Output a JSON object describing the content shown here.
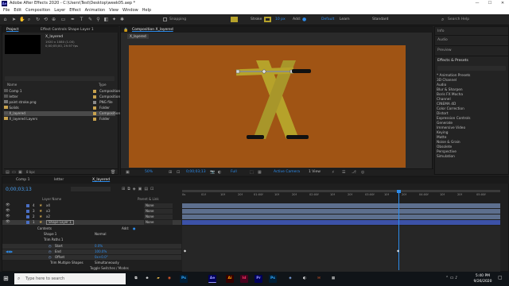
{
  "window": {
    "title": "Adobe After Effects 2020 - C:\\Users\\Test\\Desktop\\week05.aep *",
    "app_icon": "Ae"
  },
  "menu": [
    "File",
    "Edit",
    "Composition",
    "Layer",
    "Effect",
    "Animation",
    "View",
    "Window",
    "Help"
  ],
  "toolbar": {
    "snapping": "Snapping",
    "stroke": "Stroke",
    "stroke_width": "10 px",
    "add": "Add:",
    "default": "Default",
    "learn": "Learn",
    "standard": "Standard",
    "search": "Search Help"
  },
  "project": {
    "tab": "Project",
    "effect_tab": "Effect Controls Shape Layer 1",
    "preview_name": "X_layered",
    "preview_info": [
      "1920 x 1080 (1.00)",
      "0;00;05;00, 29.97 fps"
    ],
    "col_name": "Name",
    "col_type": "Type",
    "items": [
      {
        "name": "Comp 1",
        "type": "Composition",
        "color": "#c8a24e"
      },
      {
        "name": "letter",
        "type": "Composition",
        "color": "#c8a24e"
      },
      {
        "name": "paint stroke.png",
        "type": "PNG file",
        "color": "#8a8a8a"
      },
      {
        "name": "Solids",
        "type": "Folder",
        "color": "#c8a24e"
      },
      {
        "name": "X_layered",
        "type": "Composition",
        "color": "#c8a24e"
      },
      {
        "name": "X_layered Layers",
        "type": "Folder",
        "color": "#c8a24e"
      }
    ],
    "bpc": "8 bpc"
  },
  "comp": {
    "tab": "Composition X_layered",
    "crumb": "X_layered",
    "zoom": "50%",
    "time": "0;00;03;13",
    "res": "Full",
    "camera": "Active Camera",
    "view": "1 View",
    "colors": {
      "bg": "#a05414",
      "x": "#b6a22a",
      "x_dark": "#9c8a22",
      "canvas": "#2a2a2a"
    }
  },
  "right_panel": {
    "sections": [
      "Info",
      "Audio",
      "Preview"
    ],
    "effects_title": "Effects & Presets",
    "effects": [
      "* Animation Presets",
      "3D Channel",
      "Audio",
      "Blur & Sharpen",
      "Boris FX Mocha",
      "Channel",
      "CINEMA 4D",
      "Color Correction",
      "Distort",
      "Expression Controls",
      "Generate",
      "Immersive Video",
      "Keying",
      "Matte",
      "Noise & Grain",
      "Obsolete",
      "Perspective",
      "Simulation"
    ]
  },
  "timeline": {
    "tabs": [
      "Comp 1",
      "letter",
      "X_layered"
    ],
    "timecode": "0;00;03;13",
    "col_layer": "Layer Name",
    "col_parent": "Parent & Link",
    "ruler": [
      "0s",
      "01f",
      "10f",
      "20f",
      "01:00f",
      "10f",
      "20f",
      "02:00f",
      "10f",
      "20f",
      "03:00f",
      "10f",
      "20f",
      "04:00f",
      "10f",
      "20f",
      "05:00f"
    ],
    "layers": [
      {
        "num": "4",
        "name": "x4",
        "parent": "None",
        "color": "#4a6fc4"
      },
      {
        "num": "3",
        "name": "x3",
        "parent": "None",
        "color": "#4a6fc4"
      },
      {
        "num": "2",
        "name": "x2",
        "parent": "None",
        "color": "#4a6fc4"
      },
      {
        "num": "1",
        "name": "Shape Layer 1",
        "parent": "None",
        "color": "#4a6fc4"
      }
    ],
    "props": [
      {
        "name": "Contents",
        "value": "Add:"
      },
      {
        "name": "Shape 1",
        "value": "Normal"
      },
      {
        "name": "Trim Paths 1",
        "value": ""
      },
      {
        "name": "Start",
        "value": "0.0%"
      },
      {
        "name": "End",
        "value": "100.0%"
      },
      {
        "name": "Offset",
        "value": "0x+0.0°"
      },
      {
        "name": "Trim Multiple Shapes",
        "value": "Simultaneously"
      }
    ],
    "toggle": "Toggle Switches / Modes"
  },
  "taskbar": {
    "search": "Type here to search",
    "apps": [
      {
        "label": "Ps",
        "color": "#31a8ff",
        "bg": "#001e36"
      },
      {
        "label": "Ae",
        "color": "#9999ff",
        "bg": "#00005b"
      },
      {
        "label": "Ai",
        "color": "#ff9a00",
        "bg": "#330000"
      },
      {
        "label": "Id",
        "color": "#ff3366",
        "bg": "#49021f"
      },
      {
        "label": "Pr",
        "color": "#9999ff",
        "bg": "#00005b"
      },
      {
        "label": "Ps",
        "color": "#31a8ff",
        "bg": "#001e36"
      }
    ],
    "time": "5:40 PM",
    "date": "9/26/2020"
  }
}
